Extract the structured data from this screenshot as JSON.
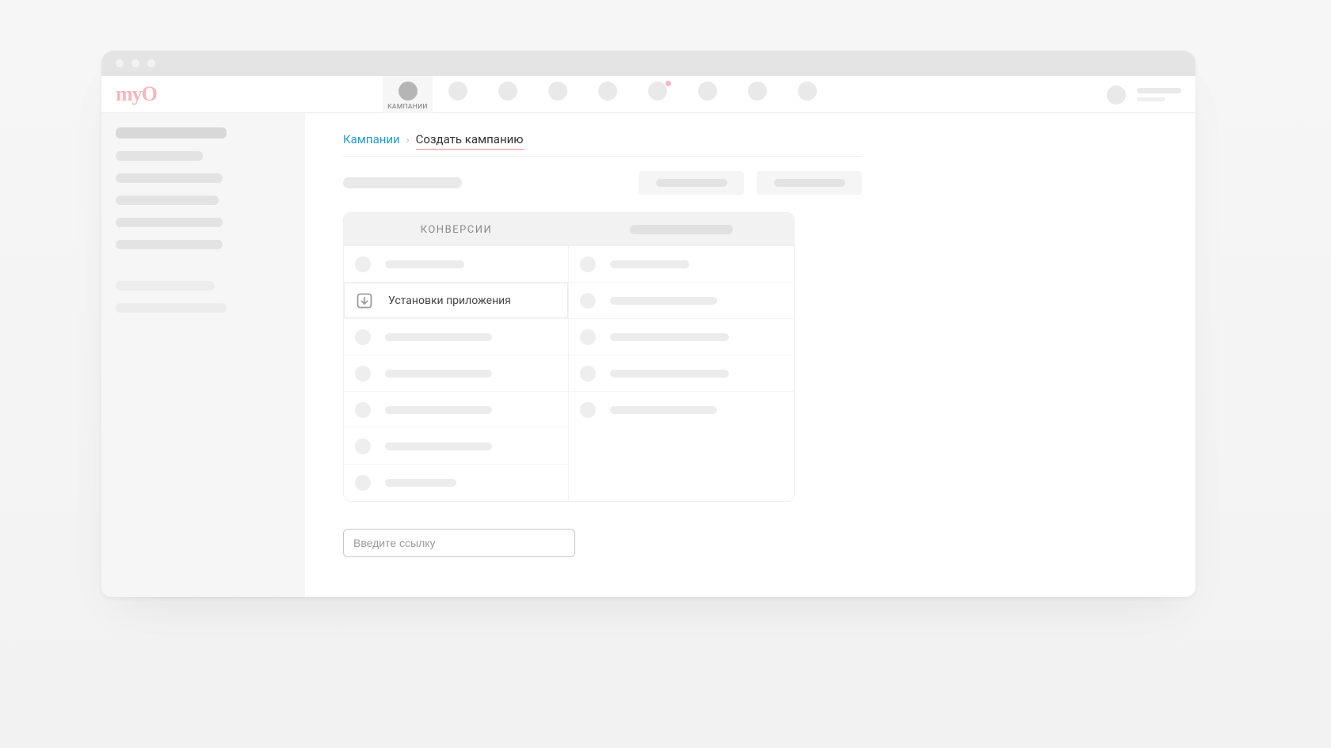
{
  "logo_text": "myO",
  "header": {
    "active_tab_label": "КАМПАНИИ"
  },
  "breadcrumbs": {
    "root": "Кампании",
    "sep": "›",
    "current": "Создать кампанию"
  },
  "card": {
    "left_header": "КОНВЕРСИИ",
    "selected_row_label": "Установки приложения"
  },
  "input": {
    "placeholder": "Введите ссылку"
  }
}
